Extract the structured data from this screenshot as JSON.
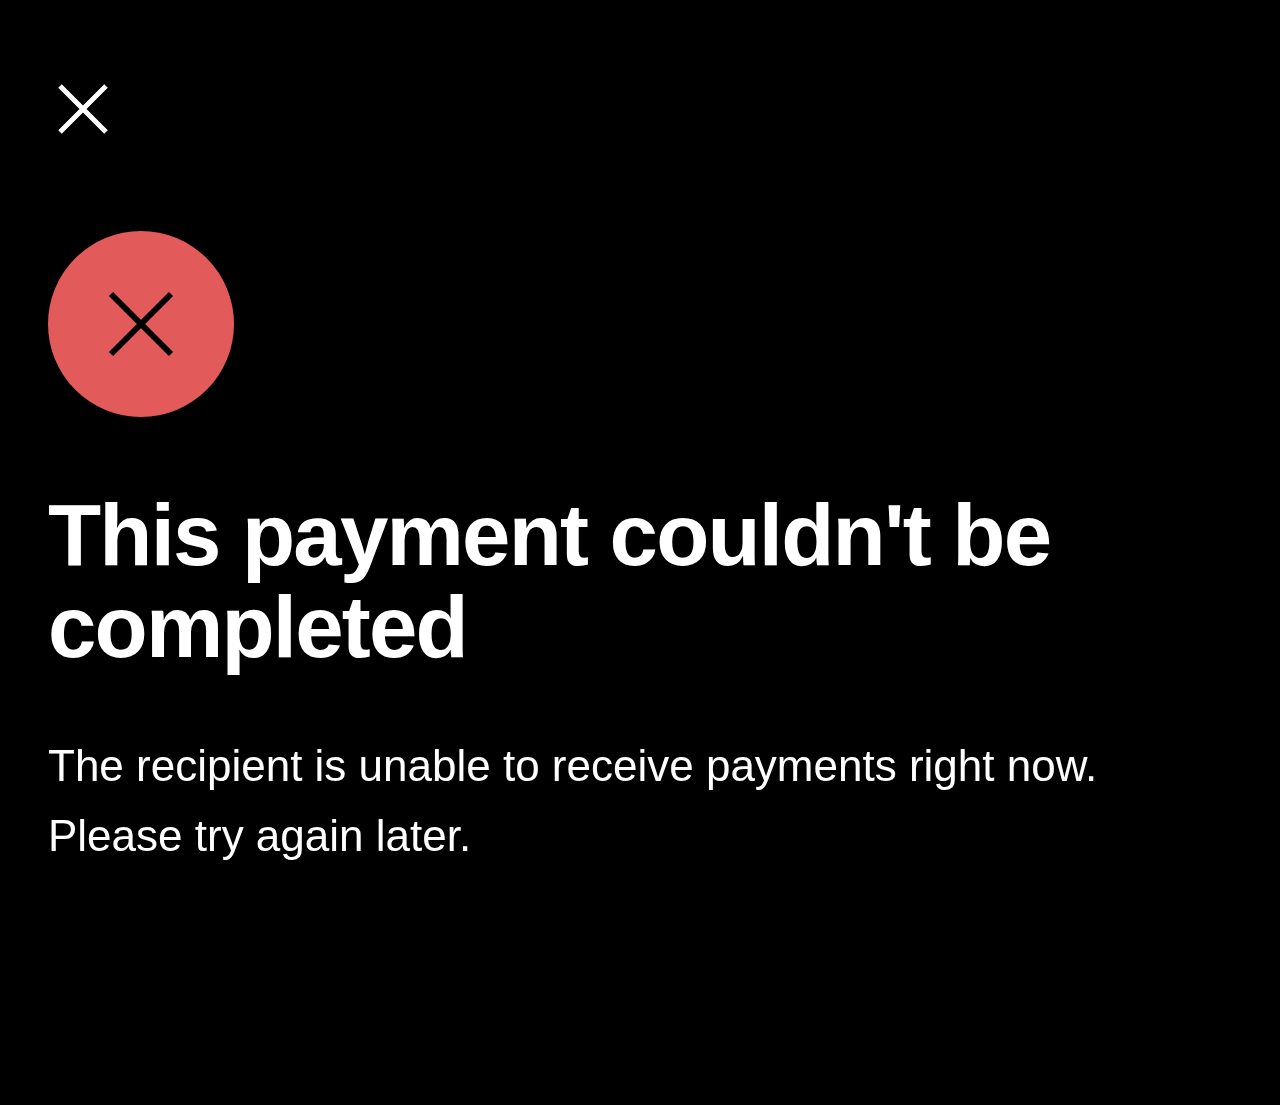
{
  "status": {
    "kind": "error"
  },
  "title": "This payment couldn't be completed",
  "message": "The recipient is unable to receive payments right now. Please try again later."
}
